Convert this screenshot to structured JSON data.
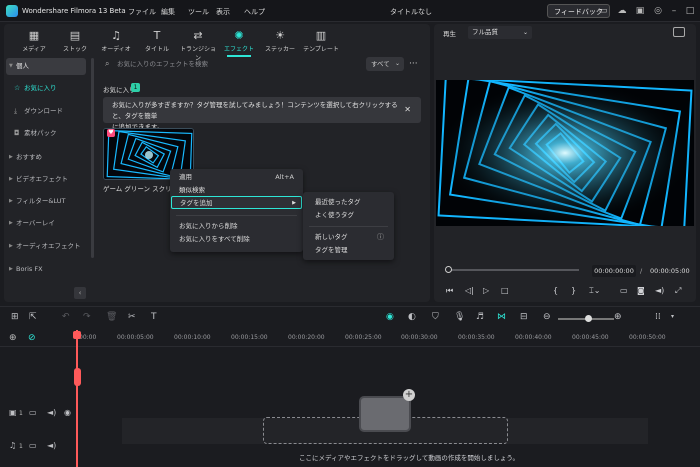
{
  "titlebar": {
    "app_title": "Wondershare Filmora 13 Beta",
    "menus": [
      "ファイル",
      "編集",
      "ツール",
      "表示",
      "ヘルプ"
    ],
    "doc_title": "タイトルなし",
    "feedback": "フィードバック"
  },
  "tabs": [
    {
      "label": "メディア",
      "icon": "media-icon"
    },
    {
      "label": "ストック",
      "icon": "stock-icon"
    },
    {
      "label": "オーディオ",
      "icon": "music-icon"
    },
    {
      "label": "タイトル",
      "icon": "title-icon"
    },
    {
      "label": "トランジション",
      "icon": "transition-icon"
    },
    {
      "label": "エフェクト",
      "icon": "effect-icon",
      "active": true
    },
    {
      "label": "ステッカー",
      "icon": "sticker-icon"
    },
    {
      "label": "テンプレート",
      "icon": "template-icon"
    }
  ],
  "sidebar": {
    "personal": "個人",
    "sub": [
      "お気に入り",
      "ダウンロード",
      "素材パック"
    ],
    "items": [
      "おすすめ",
      "ビデオエフェクト",
      "フィルター&LUT",
      "オーバーレイ",
      "オーディオエフェクト",
      "Boris FX"
    ]
  },
  "search": {
    "placeholder": "お気に入りのエフェクトを検索",
    "filter": "すべて"
  },
  "favorites": {
    "label": "お気に入り",
    "count": "1"
  },
  "notice": {
    "line1": "お気に入りが多すぎますか？タグ管理を試してみましょう！コンテンツを選択して右クリックすると、タグを簡単",
    "line2": "に追加できます。"
  },
  "thumbnail": {
    "name": "ゲーム グリーン スクリーン 13"
  },
  "context_menu": {
    "apply": "適用",
    "apply_shortcut": "Alt+A",
    "similar": "類似検索",
    "add_tag": "タグを追加",
    "remove_fav": "お気に入りから削除",
    "remove_all": "お気に入りをすべて削除"
  },
  "submenu": {
    "recent": "最近使ったタグ",
    "frequent": "よく使うタグ",
    "new_tag": "新しいタグ",
    "manage": "タグを管理"
  },
  "preview": {
    "label": "再生",
    "quality": "フル品質",
    "current_time": "00:00:00:00",
    "total_time": "00:00:05:00",
    "progress": 0
  },
  "ruler": [
    "00:00",
    "00:00:05:00",
    "00:00:10:00",
    "00:00:15:00",
    "00:00:20:00",
    "00:00:25:00",
    "00:00:30:00",
    "00:00:35:00",
    "00:00:40:00",
    "00:00:45:00",
    "00:00:50:00"
  ],
  "timeline": {
    "drop_text": "ここにメディアやエフェクトをドラッグして動画の作成を開始しましょう。",
    "track_video": "1",
    "track_audio": "1"
  },
  "colors": {
    "accent": "#2ee6d6",
    "playhead": "#ff5a5a"
  }
}
